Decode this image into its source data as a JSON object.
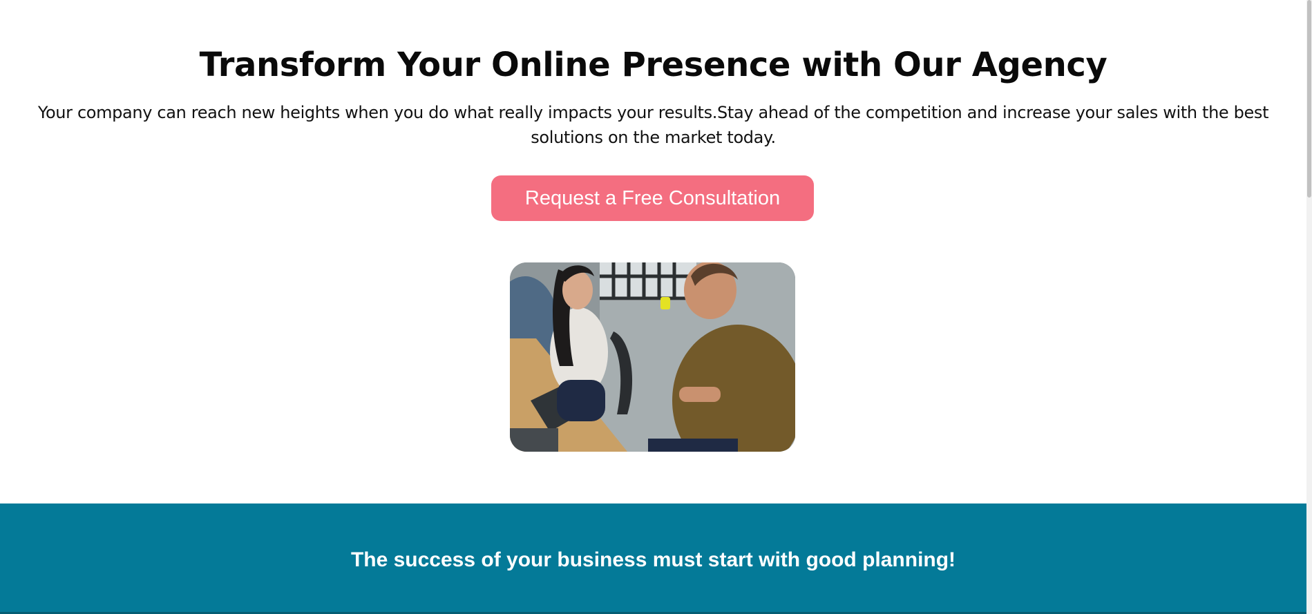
{
  "hero": {
    "title": "Transform Your Online Presence with Our Agency",
    "subtitle": "Your company can reach new heights when you do what really impacts your results.Stay ahead of the competition and increase your sales with the best solutions on the market today.",
    "cta_label": "Request a Free Consultation"
  },
  "band": {
    "title": "The success of your business must start with good planning!"
  },
  "colors": {
    "accent": "#f46e80",
    "band_background": "#047a98",
    "text": "#0a0a0a",
    "background": "#ffffff"
  }
}
